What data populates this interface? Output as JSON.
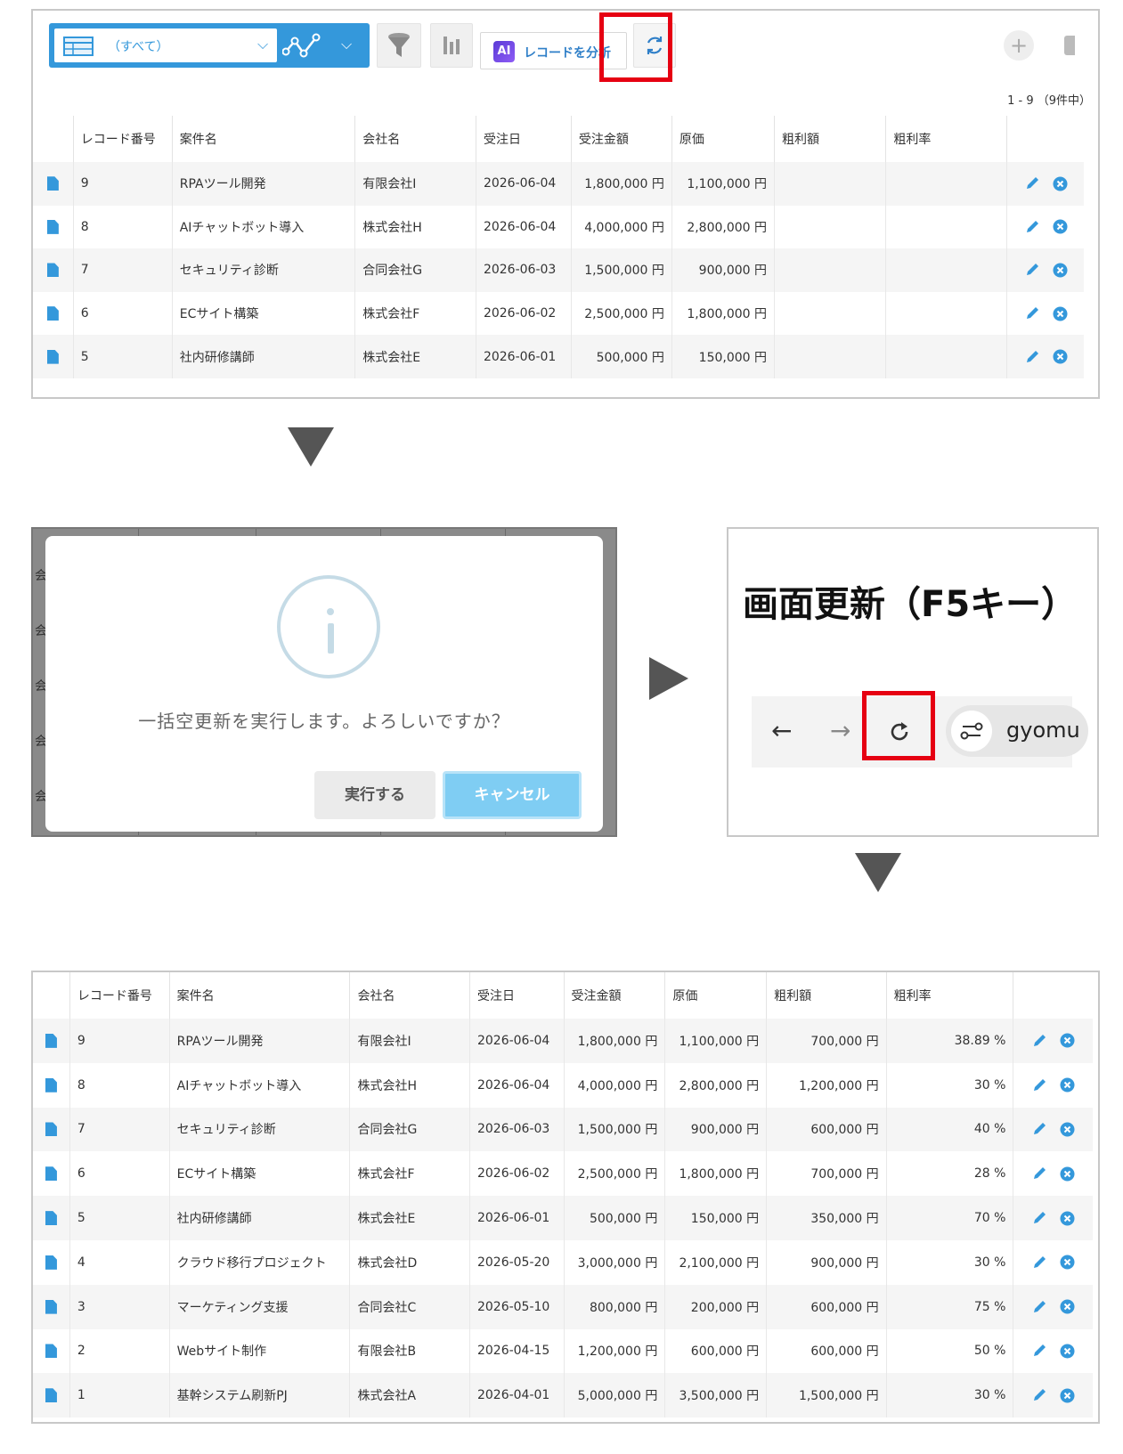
{
  "toolbar": {
    "view_label": "（すべて）",
    "ai_label": "レコードを分析",
    "ai_badge": "AI",
    "pager": "1 - 9 （9件中）"
  },
  "columns": [
    "レコード番号",
    "案件名",
    "会社名",
    "受注日",
    "受注金額",
    "原価",
    "粗利額",
    "粗利率"
  ],
  "top_rows": [
    {
      "no": "9",
      "name": "RPAツール開発",
      "company": "有限会社I",
      "date": "2026-06-04",
      "amount": "1,800,000 円",
      "cost": "1,100,000 円"
    },
    {
      "no": "8",
      "name": "AIチャットボット導入",
      "company": "株式会社H",
      "date": "2026-06-04",
      "amount": "4,000,000 円",
      "cost": "2,800,000 円"
    },
    {
      "no": "7",
      "name": "セキュリティ診断",
      "company": "合同会社G",
      "date": "2026-06-03",
      "amount": "1,500,000 円",
      "cost": "900,000 円"
    },
    {
      "no": "6",
      "name": "ECサイト構築",
      "company": "株式会社F",
      "date": "2026-06-02",
      "amount": "2,500,000 円",
      "cost": "1,800,000 円"
    },
    {
      "no": "5",
      "name": "社内研修講師",
      "company": "株式会社E",
      "date": "2026-06-01",
      "amount": "500,000 円",
      "cost": "150,000 円"
    }
  ],
  "dialog": {
    "message": "一括空更新を実行します。よろしいですか？",
    "run_label": "実行する",
    "cancel_label": "キャンセル",
    "side_chars": [
      "会",
      "会",
      "会",
      "会",
      "会"
    ]
  },
  "refresh": {
    "title": "画面更新（F5キー）",
    "url_text": "gyomu"
  },
  "bottom_rows": [
    {
      "no": "9",
      "name": "RPAツール開発",
      "company": "有限会社I",
      "date": "2026-06-04",
      "amount": "1,800,000 円",
      "cost": "1,100,000 円",
      "profit": "700,000 円",
      "rate": "38.89 %"
    },
    {
      "no": "8",
      "name": "AIチャットボット導入",
      "company": "株式会社H",
      "date": "2026-06-04",
      "amount": "4,000,000 円",
      "cost": "2,800,000 円",
      "profit": "1,200,000 円",
      "rate": "30 %"
    },
    {
      "no": "7",
      "name": "セキュリティ診断",
      "company": "合同会社G",
      "date": "2026-06-03",
      "amount": "1,500,000 円",
      "cost": "900,000 円",
      "profit": "600,000 円",
      "rate": "40 %"
    },
    {
      "no": "6",
      "name": "ECサイト構築",
      "company": "株式会社F",
      "date": "2026-06-02",
      "amount": "2,500,000 円",
      "cost": "1,800,000 円",
      "profit": "700,000 円",
      "rate": "28 %"
    },
    {
      "no": "5",
      "name": "社内研修講師",
      "company": "株式会社E",
      "date": "2026-06-01",
      "amount": "500,000 円",
      "cost": "150,000 円",
      "profit": "350,000 円",
      "rate": "70 %"
    },
    {
      "no": "4",
      "name": "クラウド移行プロジェクト",
      "company": "株式会社D",
      "date": "2026-05-20",
      "amount": "3,000,000 円",
      "cost": "2,100,000 円",
      "profit": "900,000 円",
      "rate": "30 %"
    },
    {
      "no": "3",
      "name": "マーケティング支援",
      "company": "合同会社C",
      "date": "2026-05-10",
      "amount": "800,000 円",
      "cost": "200,000 円",
      "profit": "600,000 円",
      "rate": "75 %"
    },
    {
      "no": "2",
      "name": "Webサイト制作",
      "company": "有限会社B",
      "date": "2026-04-15",
      "amount": "1,200,000 円",
      "cost": "600,000 円",
      "profit": "600,000 円",
      "rate": "50 %"
    },
    {
      "no": "1",
      "name": "基幹システム刷新PJ",
      "company": "株式会社A",
      "date": "2026-04-01",
      "amount": "5,000,000 円",
      "cost": "3,500,000 円",
      "profit": "1,500,000 円",
      "rate": "30 %"
    }
  ],
  "colors": {
    "accent": "#3498db",
    "highlight": "#e60012",
    "cancel": "#7fcdf3"
  }
}
